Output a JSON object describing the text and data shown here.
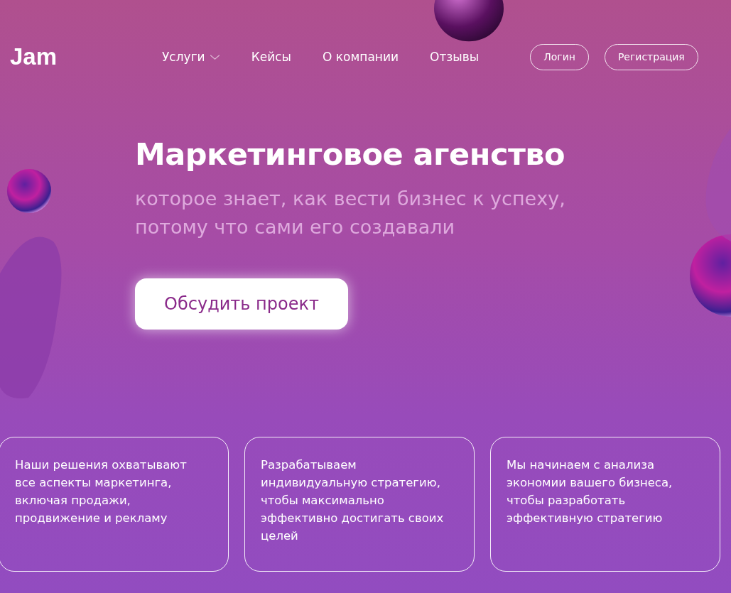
{
  "header": {
    "logo": "Jam",
    "nav": [
      {
        "label": "Услуги",
        "dropdown": true
      },
      {
        "label": "Кейсы",
        "dropdown": false
      },
      {
        "label": "О компании",
        "dropdown": false
      },
      {
        "label": "Отзывы",
        "dropdown": false
      }
    ],
    "buttons": [
      "Логин",
      "Регистрация"
    ]
  },
  "hero": {
    "title": "Маркетинговое агенство",
    "subtitle": "которое знает, как вести бизнес к успеху, потому что сами его создавали",
    "cta": "Обсудить проект"
  },
  "cards": [
    {
      "text": "Наши решения охватывают все аспекты маркетинга, включая продажи, продвижение и рекламу"
    },
    {
      "text": "Разрабатываем индивидуальную стратегию, чтобы максимально эффективно достигать своих целей"
    },
    {
      "text": "Мы начинаем с анализа экономии вашего бизнеса, чтобы разработать эффективную стратегию"
    }
  ]
}
